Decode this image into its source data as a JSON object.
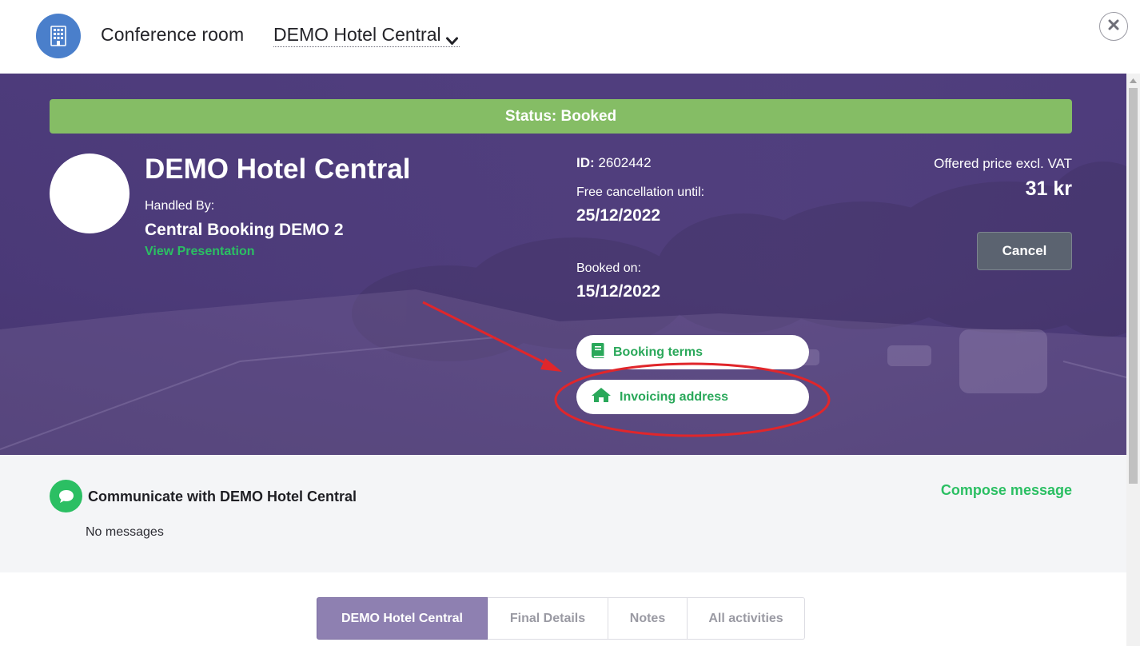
{
  "header": {
    "title": "Conference room",
    "venue_selected": "DEMO Hotel Central",
    "icons": {
      "venue": "building-icon",
      "dropdown": "chevron-down-icon",
      "close": "close-icon"
    }
  },
  "booking": {
    "status": "Status: Booked",
    "hotel_name": "DEMO Hotel Central",
    "handled_by_label": "Handled By:",
    "handled_by_name": "Central Booking DEMO 2",
    "view_presentation": "View Presentation",
    "id_label": "ID:",
    "id_value": "2602442",
    "free_cancellation_label": "Free cancellation until:",
    "free_cancellation_date": "25/12/2022",
    "booked_on_label": "Booked on:",
    "booked_on_date": "15/12/2022",
    "price_label": "Offered price excl. VAT",
    "price_value": "31 kr",
    "cancel_label": "Cancel",
    "booking_terms_label": "Booking terms",
    "invoicing_address_label": "Invoicing address",
    "icons": {
      "booking_terms": "book-icon",
      "invoicing_address": "home-icon"
    },
    "colors": {
      "status": "#85bd65",
      "accent": "#2bbf63",
      "annotation": "#e0262b"
    }
  },
  "communicate": {
    "title": "Communicate with DEMO Hotel Central",
    "compose_label": "Compose message",
    "no_messages": "No messages",
    "icon": "chat-bubble-icon"
  },
  "tabs": [
    {
      "label": "DEMO Hotel Central",
      "active": true
    },
    {
      "label": "Final Details",
      "active": false
    },
    {
      "label": "Notes",
      "active": false
    },
    {
      "label": "All activities",
      "active": false
    }
  ]
}
